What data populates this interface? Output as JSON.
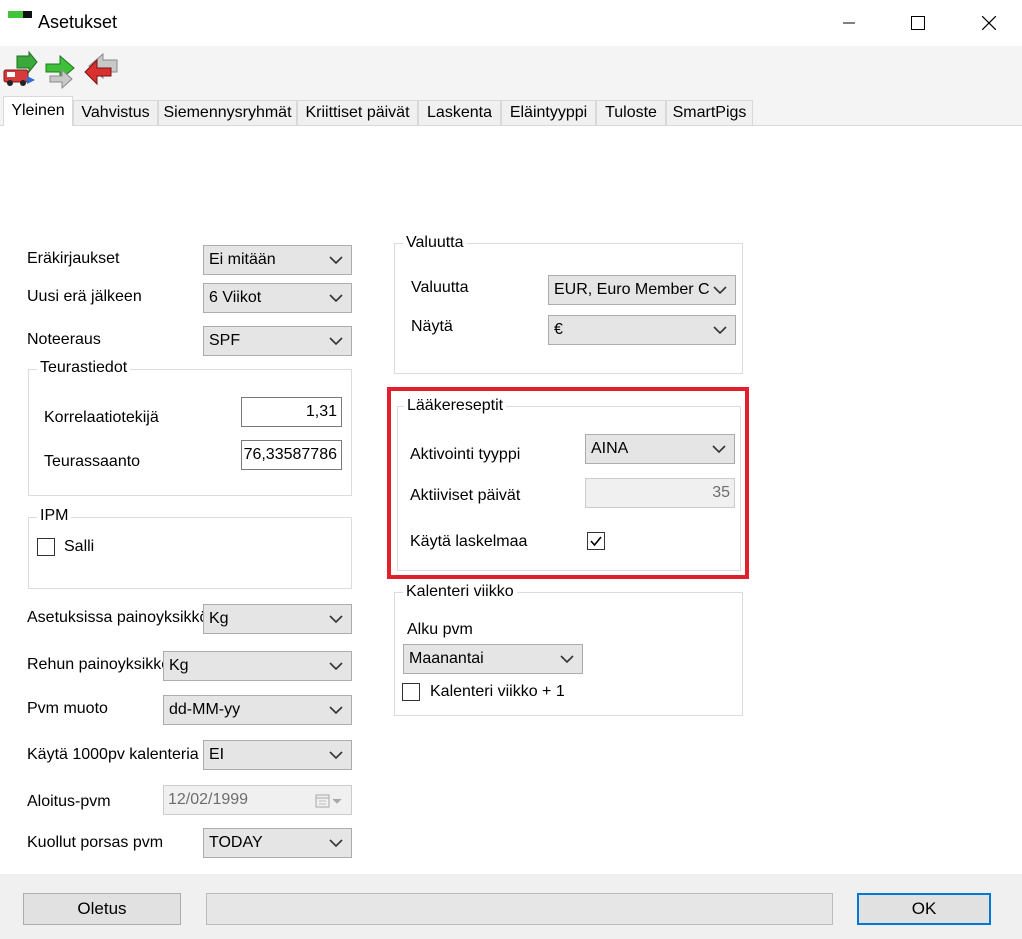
{
  "window": {
    "title": "Asetukset"
  },
  "toolbar": {
    "icons": [
      "vehicle-save-icon",
      "green-arrow-icon",
      "red-arrow-icon"
    ]
  },
  "tabs": [
    "Yleinen",
    "Vahvistus",
    "Siemennysryhmät",
    "Kriittiset päivät",
    "Laskenta",
    "Eläintyyppi",
    "Tuloste",
    "SmartPigs"
  ],
  "active_tab": "Yleinen",
  "general": {
    "erakirjaukset": {
      "label": "Eräkirjaukset",
      "value": "Ei mitään"
    },
    "uusi_era": {
      "label": "Uusi erä jälkeen",
      "value": "6 Viikot"
    },
    "noteeraus": {
      "label": "Noteeraus",
      "value": "SPF"
    },
    "teurastiedot": {
      "title": "Teurastiedot",
      "korrelaatio": {
        "label": "Korrelaatiotekijä",
        "value": "1,31"
      },
      "teurassaanto": {
        "label": "Teurassaanto",
        "value": "76,33587786"
      }
    },
    "ipm": {
      "title": "IPM",
      "salli": {
        "label": "Salli",
        "checked": false
      }
    },
    "asetus_paino": {
      "label": "Asetuksissa painoyksikkö",
      "value": "Kg"
    },
    "rehu_paino": {
      "label": "Rehun painoyksikkö",
      "value": "Kg"
    },
    "pvm_muoto": {
      "label": "Pvm muoto",
      "value": "dd-MM-yy"
    },
    "kalenteri1000": {
      "label": "Käytä 1000pv kalenteria",
      "value": "EI"
    },
    "aloitus_pvm": {
      "label": "Aloitus-pvm",
      "value": "12/02/1999"
    },
    "kuollut_porsas": {
      "label": "Kuollut porsas pvm",
      "value": "TODAY"
    }
  },
  "valuutta": {
    "title": "Valuutta",
    "valuutta": {
      "label": "Valuutta",
      "value": "EUR, Euro Member C"
    },
    "nayta": {
      "label": "Näytä",
      "value": "€"
    }
  },
  "laakereseptit": {
    "title": "Lääkereseptit",
    "aktivointi": {
      "label": "Aktivointi tyyppi",
      "value": "AINA"
    },
    "aktiiviset": {
      "label": "Aktiiviset päivät",
      "value": "35"
    },
    "kayta_laskelmaa": {
      "label": "Käytä laskelmaa",
      "checked": true
    },
    "highlight_color": "#e0212b"
  },
  "kalenteri": {
    "title": "Kalenteri viikko",
    "alku_label": "Alku pvm",
    "alku_value": "Maanantai",
    "plus1": {
      "label": "Kalenteri viikko + 1",
      "checked": false
    }
  },
  "bottom": {
    "oletus_label": "Oletus",
    "ok_label": "OK",
    "status_text": ""
  },
  "accent_color": "#0078d7"
}
